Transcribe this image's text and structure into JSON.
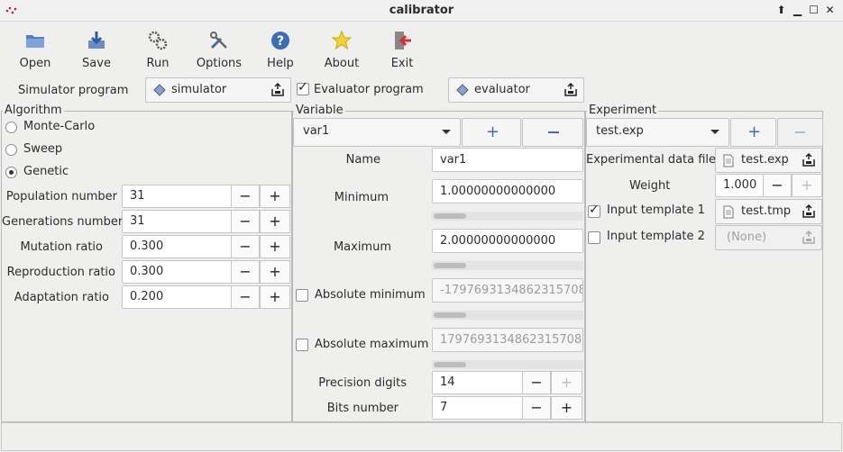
{
  "window": {
    "title": "calibrator"
  },
  "toolbar": {
    "open": "Open",
    "save": "Save",
    "run": "Run",
    "options": "Options",
    "help": "Help",
    "about": "About",
    "exit": "Exit"
  },
  "programs": {
    "simulator_label": "Simulator program",
    "simulator_value": "simulator",
    "evaluator_label": "Evaluator program",
    "evaluator_checked": true,
    "evaluator_value": "evaluator"
  },
  "algorithm": {
    "title": "Algorithm",
    "options": [
      "Monte-Carlo",
      "Sweep",
      "Genetic"
    ],
    "selected": "Genetic",
    "params": [
      {
        "label": "Population number",
        "value": "31"
      },
      {
        "label": "Generations number",
        "value": "31"
      },
      {
        "label": "Mutation ratio",
        "value": "0.300"
      },
      {
        "label": "Reproduction ratio",
        "value": "0.300"
      },
      {
        "label": "Adaptation ratio",
        "value": "0.200"
      }
    ]
  },
  "variable": {
    "title": "Variable",
    "selected": "var1",
    "name_label": "Name",
    "name_value": "var1",
    "minimum_label": "Minimum",
    "minimum_value": "1.00000000000000",
    "maximum_label": "Maximum",
    "maximum_value": "2.00000000000000",
    "abs_min_label": "Absolute minimum",
    "abs_min_value": "-1797693134862315708",
    "abs_max_label": "Absolute maximum",
    "abs_max_value": "1797693134862315708",
    "precision_label": "Precision digits",
    "precision_value": "14",
    "bits_label": "Bits number",
    "bits_value": "7"
  },
  "experiment": {
    "title": "Experiment",
    "selected": "test.exp",
    "data_file_label": "Experimental data file",
    "data_file_value": "test.exp",
    "weight_label": "Weight",
    "weight_value": "1.000",
    "template1_label": "Input template 1",
    "template1_value": "test.tmp",
    "template1_checked": true,
    "template2_label": "Input template 2",
    "template2_value": "(None)",
    "template2_checked": false
  },
  "symbols": {
    "plus": "+",
    "minus": "−"
  },
  "colors": {
    "accent": "#3a6fb5",
    "background": "#efefee"
  }
}
